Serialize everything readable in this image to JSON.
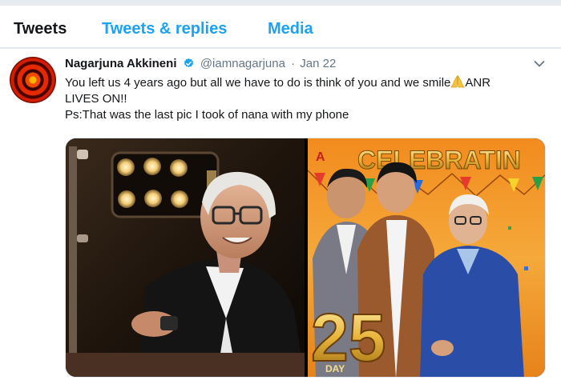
{
  "tabs": [
    {
      "label": "Tweets",
      "active": true
    },
    {
      "label": "Tweets & replies",
      "active": false
    },
    {
      "label": "Media",
      "active": false
    }
  ],
  "tweet": {
    "user_name": "Nagarjuna Akkineni",
    "handle": "@iamnagarjuna",
    "separator": "·",
    "date": "Jan 22",
    "verified": true,
    "text_line1_before_emoji": "You left us 4 years ago but all we have to do is think of you and we smile",
    "text_line1_after_emoji": "ANR",
    "text_line2": "LIVES ON!!",
    "text_line3": "Ps:That was the last pic I took of nana with my phone",
    "emoji": "folded-hands",
    "media": {
      "left_photo": "portrait-photo",
      "right_photo": "movie-poster",
      "poster_text_top": "CELEBRATIN",
      "poster_text_bottom": "25",
      "poster_text_day": "DAY"
    }
  },
  "colors": {
    "accent": "#1da1f2",
    "text": "#14171a",
    "muted": "#657786",
    "background": "#e6ecf0"
  }
}
